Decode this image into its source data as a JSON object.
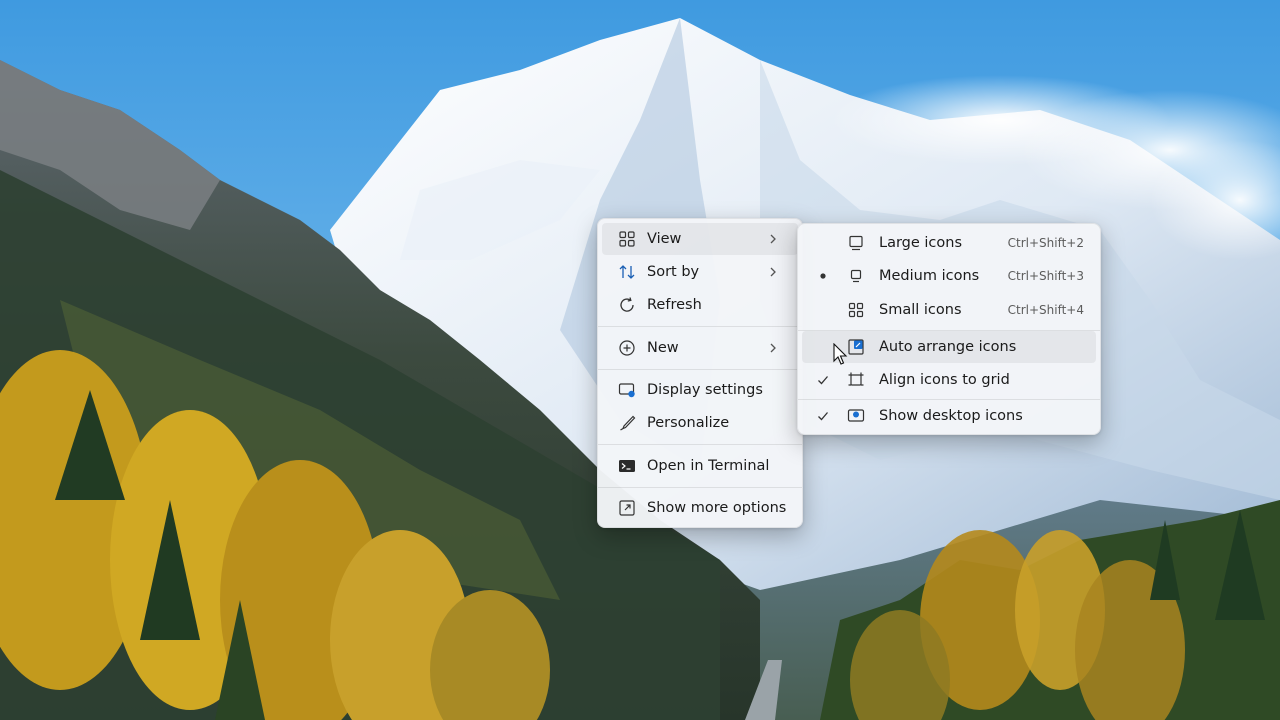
{
  "context_menu": {
    "items": [
      {
        "label": "View",
        "icon": "view-grid-icon",
        "has_submenu": true
      },
      {
        "label": "Sort by",
        "icon": "sort-icon",
        "has_submenu": true
      },
      {
        "label": "Refresh",
        "icon": "refresh-icon",
        "has_submenu": false
      },
      {
        "label": "New",
        "icon": "new-plus-icon",
        "has_submenu": true
      },
      {
        "label": "Display settings",
        "icon": "display-settings-icon",
        "has_submenu": false
      },
      {
        "label": "Personalize",
        "icon": "personalize-brush-icon",
        "has_submenu": false
      },
      {
        "label": "Open in Terminal",
        "icon": "terminal-icon",
        "has_submenu": false
      },
      {
        "label": "Show more options",
        "icon": "show-more-options-icon",
        "has_submenu": false
      }
    ]
  },
  "view_submenu": {
    "items": [
      {
        "label": "Large icons",
        "shortcut": "Ctrl+Shift+2",
        "icon": "large-icons-icon",
        "mark": ""
      },
      {
        "label": "Medium icons",
        "shortcut": "Ctrl+Shift+3",
        "icon": "medium-icons-icon",
        "mark": "bullet"
      },
      {
        "label": "Small icons",
        "shortcut": "Ctrl+Shift+4",
        "icon": "small-icons-icon",
        "mark": ""
      },
      {
        "label": "Auto arrange icons",
        "shortcut": "",
        "icon": "auto-arrange-icon",
        "mark": ""
      },
      {
        "label": "Align icons to grid",
        "shortcut": "",
        "icon": "align-grid-icon",
        "mark": "check"
      },
      {
        "label": "Show desktop icons",
        "shortcut": "",
        "icon": "show-desktop-icon",
        "mark": "check"
      }
    ]
  },
  "colors": {
    "menu_bg": "#f3f5f8",
    "accent": "#0067c0",
    "sky": "#4a9ede"
  }
}
